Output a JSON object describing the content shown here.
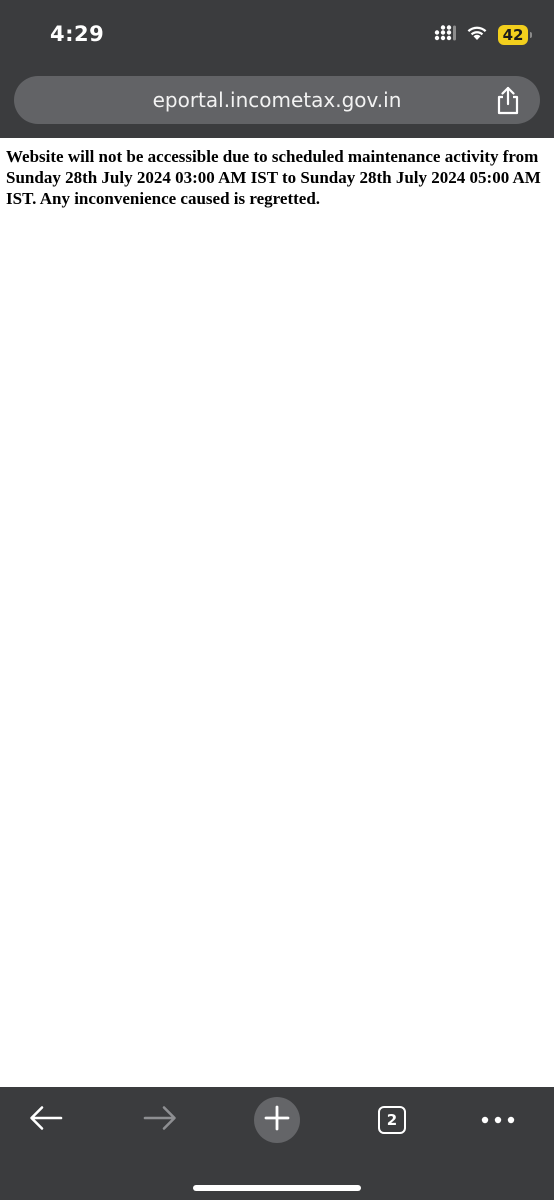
{
  "status_bar": {
    "time": "4:29",
    "battery_level": "42",
    "battery_color": "#f2cf1d",
    "icons": [
      "signal-icon",
      "wifi-icon",
      "battery-icon"
    ]
  },
  "address_bar": {
    "url": "eportal.incometax.gov.in",
    "share_icon": "share-icon"
  },
  "content": {
    "message": "Website will not be accessible due to scheduled maintenance activity from Sunday 28th July 2024 03:00 AM IST to Sunday 28th July 2024 05:00 AM IST. Any inconvenience caused is regretted."
  },
  "toolbar": {
    "back_icon": "back-arrow-icon",
    "forward_icon": "forward-arrow-icon",
    "new_tab_icon": "plus-icon",
    "tab_count": "2",
    "menu_icon": "more-dots-icon"
  },
  "colors": {
    "chrome_bg": "#3b3c3e",
    "pill_bg": "#626366",
    "page_bg": "#ffffff"
  }
}
